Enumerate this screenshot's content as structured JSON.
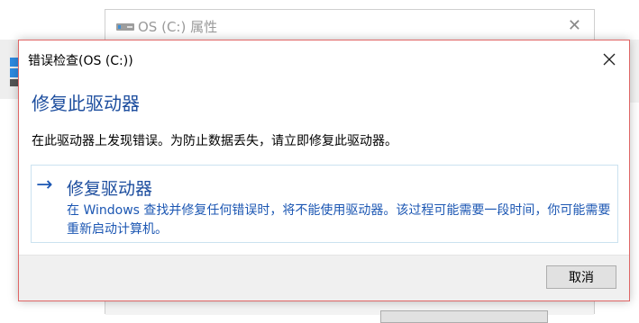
{
  "background_window": {
    "title": "OS (C:) 属性",
    "close_glyph": "✕",
    "icon": "drive-icon"
  },
  "dialog": {
    "title": "错误检查(OS (C:))",
    "heading": "修复此驱动器",
    "description": "在此驱动器上发现错误。为防止数据丢失，请立即修复此驱动器。",
    "option": {
      "arrow_glyph": "→",
      "label": "修复驱动器",
      "description": "在 Windows 查找并修复任何错误时，将不能使用驱动器。该过程可能需要一段时间，你可能需要重新启动计算机。"
    },
    "cancel_label": "取消",
    "close_icon": "close-icon"
  },
  "colors": {
    "heading": "#1c4d9e",
    "link": "#1c57b3",
    "dialog_border": "#e06666",
    "footer": "#f0f0f0"
  }
}
